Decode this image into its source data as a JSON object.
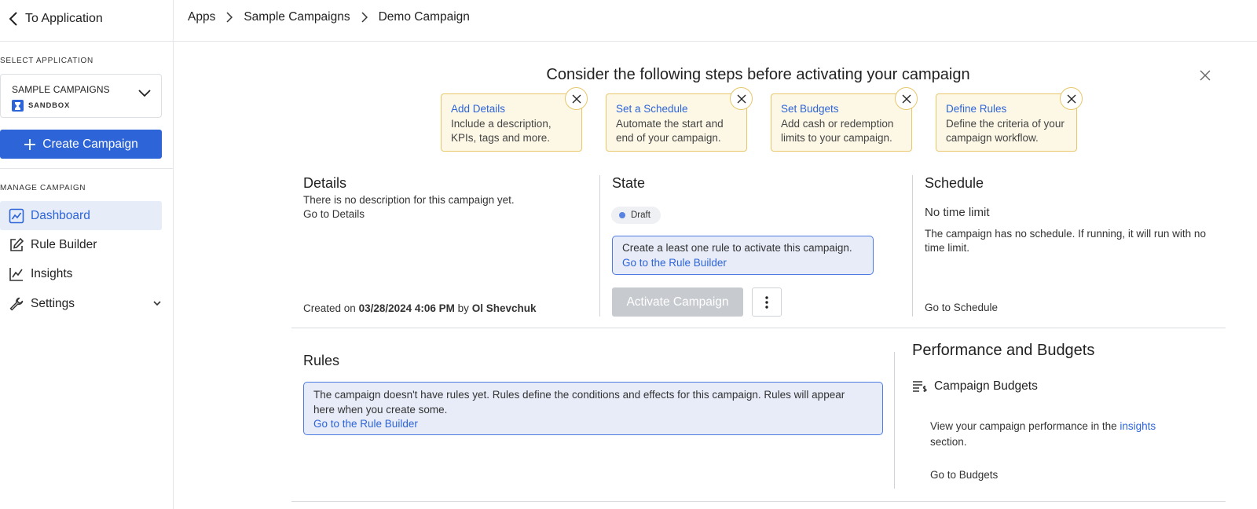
{
  "sidebar": {
    "back_label": "To Application",
    "select_application_label": "SELECT APPLICATION",
    "app_name": "SAMPLE CAMPAIGNS",
    "app_env": "SANDBOX",
    "create_label": "Create Campaign",
    "manage_label": "MANAGE CAMPAIGN",
    "items": [
      {
        "label": "Dashboard",
        "icon": "dashboard-icon"
      },
      {
        "label": "Rule Builder",
        "icon": "edit-icon"
      },
      {
        "label": "Insights",
        "icon": "line-chart-icon"
      },
      {
        "label": "Settings",
        "icon": "wrench-icon"
      }
    ]
  },
  "breadcrumb": [
    "Apps",
    "Sample Campaigns",
    "Demo Campaign"
  ],
  "steps": {
    "title": "Consider the following steps before activating your campaign",
    "cards": [
      {
        "title": "Add Details",
        "desc1": "Include a description,",
        "desc2": "KPIs, tags and more."
      },
      {
        "title": "Set a Schedule",
        "desc1": "Automate the start and",
        "desc2": "end of your campaign."
      },
      {
        "title": "Set Budgets",
        "desc1": "Add cash or redemption",
        "desc2": "limits to your campaign."
      },
      {
        "title": "Define Rules",
        "desc1": "Define the criteria of your",
        "desc2": "campaign workflow."
      }
    ]
  },
  "details": {
    "title": "Details",
    "desc": "There is no description for this campaign yet.",
    "link": "Go to Details",
    "created_prefix": "Created on",
    "created_date": "03/28/2024 4:06 PM",
    "created_by": "by",
    "author": "Ol Shevchuk"
  },
  "state": {
    "title": "State",
    "badge": "Draft",
    "info_text": "Create a least one rule to activate this campaign.",
    "info_link": "Go to the Rule Builder",
    "activate_label": "Activate Campaign"
  },
  "schedule": {
    "title": "Schedule",
    "subtitle": "No time limit",
    "line1": "The campaign has no schedule. If running, it will run with no",
    "line2": "time limit.",
    "link": "Go to Schedule"
  },
  "rules": {
    "title": "Rules",
    "line1": "The campaign doesn't have rules yet. Rules define the conditions and effects for this campaign. Rules will appear",
    "line2": "here when you create some.",
    "link": "Go to the Rule Builder"
  },
  "performance": {
    "title": "Performance and Budgets",
    "budgets_label": "Campaign Budgets",
    "view_text": "View your campaign performance in the",
    "insights_link": "insights",
    "section_text": "section.",
    "budgets_link": "Go to Budgets"
  },
  "colors": {
    "accent": "#2d64d8",
    "step_bg": "#fdf8e6",
    "step_border": "#e8c66a",
    "info_bg": "#e7ecf8",
    "disabled": "#c7cacf"
  }
}
